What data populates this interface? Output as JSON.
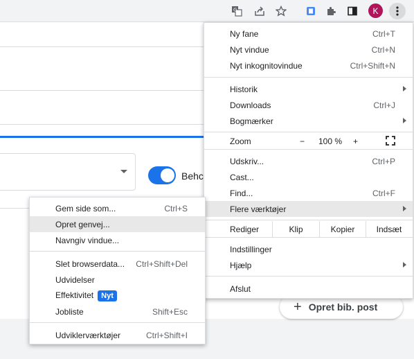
{
  "toolbar": {
    "icons": [
      "translate-icon",
      "share-icon",
      "star-icon",
      "extension-badge-icon",
      "puzzle-icon",
      "sidepanel-icon"
    ],
    "avatar_letter": "K",
    "menu_button": "kebab-icon"
  },
  "page": {
    "toggle_label": "Behc",
    "fab_icon": "+",
    "fab_label": "Opret bib. post"
  },
  "menu": {
    "new_tab": {
      "label": "Ny fane",
      "shortcut": "Ctrl+T"
    },
    "new_window": {
      "label": "Nyt vindue",
      "shortcut": "Ctrl+N"
    },
    "incognito": {
      "label": "Nyt inkognitovindue",
      "shortcut": "Ctrl+Shift+N"
    },
    "history": {
      "label": "Historik"
    },
    "downloads": {
      "label": "Downloads",
      "shortcut": "Ctrl+J"
    },
    "bookmarks": {
      "label": "Bogmærker"
    },
    "zoom": {
      "label": "Zoom",
      "minus": "−",
      "value": "100 %",
      "plus": "+"
    },
    "print": {
      "label": "Udskriv...",
      "shortcut": "Ctrl+P"
    },
    "cast": {
      "label": "Cast..."
    },
    "find": {
      "label": "Find...",
      "shortcut": "Ctrl+F"
    },
    "more_tools": {
      "label": "Flere værktøjer"
    },
    "edit": {
      "label": "Rediger",
      "cut": "Klip",
      "copy": "Kopier",
      "paste": "Indsæt"
    },
    "settings": {
      "label": "Indstillinger"
    },
    "help": {
      "label": "Hjælp"
    },
    "exit": {
      "label": "Afslut"
    }
  },
  "submenu": {
    "save_page": {
      "label": "Gem side som...",
      "shortcut": "Ctrl+S"
    },
    "create_shortcut": {
      "label": "Opret genvej..."
    },
    "name_window": {
      "label": "Navngiv vindue..."
    },
    "clear_data": {
      "label": "Slet browserdata...",
      "shortcut": "Ctrl+Shift+Del"
    },
    "extensions": {
      "label": "Udvidelser"
    },
    "performance": {
      "label": "Effektivitet",
      "badge": "Nyt"
    },
    "task_manager": {
      "label": "Jobliste",
      "shortcut": "Shift+Esc"
    },
    "dev_tools": {
      "label": "Udviklerværktøjer",
      "shortcut": "Ctrl+Shift+I"
    }
  }
}
